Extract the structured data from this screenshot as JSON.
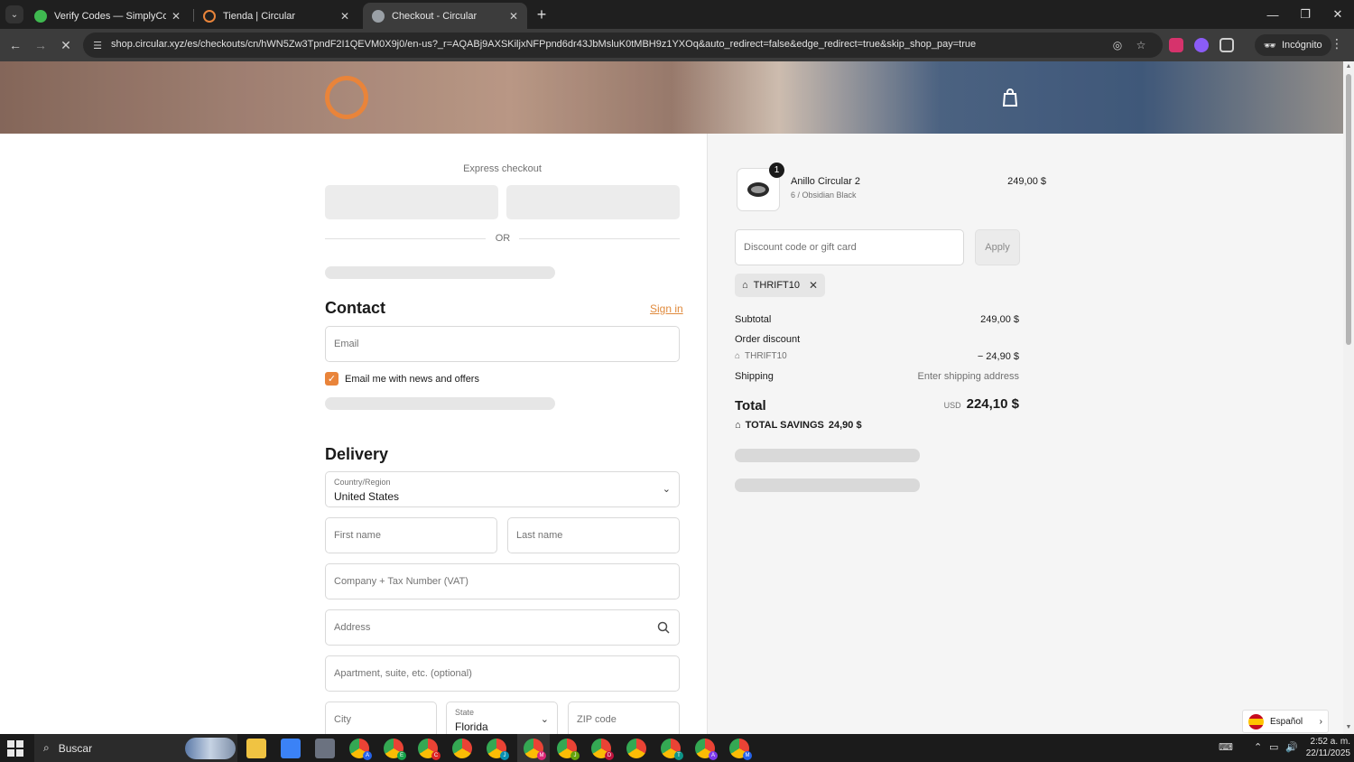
{
  "browser": {
    "tabs": [
      {
        "title": "Verify Codes — SimplyCodes",
        "favicon_color": "#3fb950"
      },
      {
        "title": "Tienda | Circular",
        "favicon_color": "#e9843a"
      },
      {
        "title": "Checkout - Circular",
        "favicon_color": "#9aa0a6"
      }
    ],
    "url": "shop.circular.xyz/es/checkouts/cn/hWN5Zw3TpndF2I1QEVM0X9j0/en-us?_r=AQABj9AXSKiljxNFPpnd6dr43JbMsluK0tMBH9z1YXOq&auto_redirect=false&edge_redirect=true&skip_shop_pay=true",
    "incognito_label": "Incógnito"
  },
  "checkout": {
    "express_title": "Express checkout",
    "or_label": "OR",
    "contact": {
      "heading": "Contact",
      "sign_in": "Sign in",
      "email_placeholder": "Email",
      "newsletter_label": "Email me with news and offers",
      "newsletter_checked": true
    },
    "delivery": {
      "heading": "Delivery",
      "country_label": "Country/Region",
      "country_value": "United States",
      "first_name_placeholder": "First name",
      "last_name_placeholder": "Last name",
      "company_placeholder": "Company + Tax Number (VAT)",
      "address_placeholder": "Address",
      "apartment_placeholder": "Apartment, suite, etc. (optional)",
      "city_placeholder": "City",
      "state_label": "State",
      "state_value": "Florida",
      "zip_placeholder": "ZIP code"
    }
  },
  "summary": {
    "product": {
      "quantity": "1",
      "name": "Anillo Circular 2",
      "variant": "6 / Obsidian Black",
      "price": "249,00 $"
    },
    "discount_placeholder": "Discount code or gift card",
    "apply_label": "Apply",
    "applied_code": "THRIFT10",
    "subtotal_label": "Subtotal",
    "subtotal_value": "249,00 $",
    "order_discount_label": "Order discount",
    "discount_code": "THRIFT10",
    "discount_value": "− 24,90 $",
    "shipping_label": "Shipping",
    "shipping_value": "Enter shipping address",
    "total_label": "Total",
    "total_currency": "USD",
    "total_value": "224,10 $",
    "savings_label": "TOTAL SAVINGS",
    "savings_value": "24,90 $"
  },
  "language": {
    "label": "Español"
  },
  "taskbar": {
    "search_label": "Buscar",
    "time": "2:52 a. m.",
    "date": "22/11/2025"
  },
  "colors": {
    "accent": "#e9843a"
  }
}
